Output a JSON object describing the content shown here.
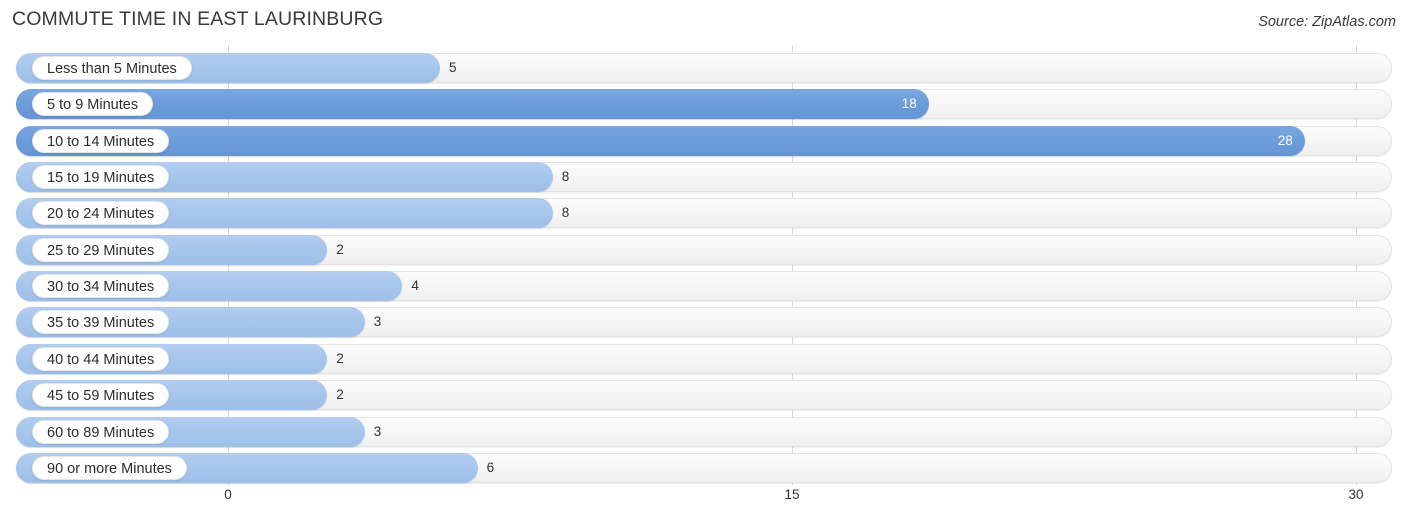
{
  "header": {
    "title": "COMMUTE TIME IN EAST LAURINBURG",
    "source": "Source: ZipAtlas.com"
  },
  "chart_data": {
    "type": "bar",
    "orientation": "horizontal",
    "title": "COMMUTE TIME IN EAST LAURINBURG",
    "subtitle": "",
    "xlabel": "",
    "ylabel": "",
    "xlim": [
      0,
      30
    ],
    "xticks": [
      0,
      15,
      30
    ],
    "xtick_labels": [
      "0",
      "15",
      "30"
    ],
    "grid": true,
    "legend": false,
    "colors": {
      "bar_light": "#a6c6ec",
      "bar_dark": "#6c9cda",
      "track": "#f6f6f6",
      "gridline": "#d9d9d9",
      "value_label_outside": "#333333",
      "value_label_inside": "#ffffff"
    },
    "categories": [
      "Less than 5 Minutes",
      "5 to 9 Minutes",
      "10 to 14 Minutes",
      "15 to 19 Minutes",
      "20 to 24 Minutes",
      "25 to 29 Minutes",
      "30 to 34 Minutes",
      "35 to 39 Minutes",
      "40 to 44 Minutes",
      "45 to 59 Minutes",
      "60 to 89 Minutes",
      "90 or more Minutes"
    ],
    "values": [
      5,
      18,
      28,
      8,
      8,
      2,
      4,
      3,
      2,
      2,
      3,
      6
    ],
    "value_labels": [
      "5",
      "18",
      "28",
      "8",
      "8",
      "2",
      "4",
      "3",
      "2",
      "2",
      "3",
      "6"
    ]
  },
  "rows": [
    {
      "label": "Less than 5 Minutes",
      "value": 5,
      "value_label": "5",
      "emphasis": "light",
      "label_inside": false
    },
    {
      "label": "5 to 9 Minutes",
      "value": 18,
      "value_label": "18",
      "emphasis": "dark",
      "label_inside": true
    },
    {
      "label": "10 to 14 Minutes",
      "value": 28,
      "value_label": "28",
      "emphasis": "dark",
      "label_inside": true
    },
    {
      "label": "15 to 19 Minutes",
      "value": 8,
      "value_label": "8",
      "emphasis": "light",
      "label_inside": false
    },
    {
      "label": "20 to 24 Minutes",
      "value": 8,
      "value_label": "8",
      "emphasis": "light",
      "label_inside": false
    },
    {
      "label": "25 to 29 Minutes",
      "value": 2,
      "value_label": "2",
      "emphasis": "light",
      "label_inside": false
    },
    {
      "label": "30 to 34 Minutes",
      "value": 4,
      "value_label": "4",
      "emphasis": "light",
      "label_inside": false
    },
    {
      "label": "35 to 39 Minutes",
      "value": 3,
      "value_label": "3",
      "emphasis": "light",
      "label_inside": false
    },
    {
      "label": "40 to 44 Minutes",
      "value": 2,
      "value_label": "2",
      "emphasis": "light",
      "label_inside": false
    },
    {
      "label": "45 to 59 Minutes",
      "value": 2,
      "value_label": "2",
      "emphasis": "light",
      "label_inside": false
    },
    {
      "label": "60 to 89 Minutes",
      "value": 3,
      "value_label": "3",
      "emphasis": "light",
      "label_inside": false
    },
    {
      "label": "90 or more Minutes",
      "value": 6,
      "value_label": "6",
      "emphasis": "light",
      "label_inside": false
    }
  ],
  "axis": {
    "ticks": [
      {
        "label": "0",
        "value": 0
      },
      {
        "label": "15",
        "value": 15
      },
      {
        "label": "30",
        "value": 30
      }
    ]
  }
}
